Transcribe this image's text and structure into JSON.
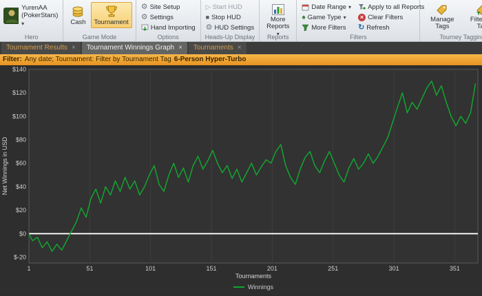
{
  "ribbon": {
    "hero": {
      "name": "YurenAA",
      "site": "(PokerStars)",
      "caption": "Hero"
    },
    "game_mode": {
      "caption": "Game Mode",
      "cash_label": "Cash",
      "tournament_label": "Tournament"
    },
    "options": {
      "caption": "Options",
      "items": [
        "Site Setup",
        "Settings",
        "Hand Importing"
      ]
    },
    "hud": {
      "caption": "Heads-Up Display",
      "items": [
        "Start HUD",
        "Stop HUD",
        "HUD Settings"
      ]
    },
    "reports": {
      "caption": "Reports",
      "more_reports_label": "More Reports"
    },
    "filters": {
      "caption": "Filters",
      "items": [
        "Date Range",
        "Game Type",
        "More Filters",
        "Apply to all Reports",
        "Clear Filters",
        "Refresh"
      ]
    },
    "tagging": {
      "caption": "Tourney Tagging",
      "manage_label": "Manage Tags",
      "filter_label": "Filter for Tag"
    }
  },
  "tabs": [
    {
      "label": "Tournament Results",
      "active": false
    },
    {
      "label": "Tournament Winnings Graph",
      "active": true
    },
    {
      "label": "Tournaments",
      "active": false
    }
  ],
  "filter_bar": {
    "prefix": "Filter:",
    "text": "Any date; Tournament: Filter by Tournament Tag",
    "tag": "6-Person Hyper-Turbo"
  },
  "chart_data": {
    "type": "line",
    "title": "",
    "xlabel": "Tournaments",
    "ylabel": "Net Winnings in USD",
    "xlim": [
      1,
      370
    ],
    "ylim": [
      -25,
      140
    ],
    "x_ticks": [
      1,
      51,
      101,
      151,
      201,
      251,
      301,
      351
    ],
    "y_ticks": [
      140,
      120,
      100,
      80,
      60,
      40,
      20,
      0,
      -20
    ],
    "y_tick_prefix": "$",
    "grid": "vertical-only",
    "zero_line": true,
    "legend_position": "bottom",
    "line_color": "#12a530",
    "background": "#323232",
    "series": [
      {
        "name": "Winnings",
        "x": [
          1,
          4,
          8,
          12,
          16,
          20,
          24,
          28,
          32,
          36,
          40,
          44,
          48,
          52,
          56,
          60,
          64,
          68,
          72,
          76,
          80,
          84,
          88,
          92,
          96,
          100,
          104,
          108,
          112,
          116,
          120,
          124,
          128,
          132,
          136,
          140,
          144,
          148,
          152,
          156,
          160,
          164,
          168,
          172,
          176,
          180,
          184,
          188,
          192,
          196,
          200,
          204,
          208,
          212,
          216,
          220,
          224,
          228,
          232,
          236,
          240,
          244,
          248,
          252,
          256,
          260,
          264,
          268,
          272,
          276,
          280,
          284,
          288,
          292,
          296,
          300,
          304,
          308,
          312,
          316,
          320,
          324,
          328,
          332,
          336,
          340,
          344,
          348,
          352,
          356,
          360,
          364,
          368
        ],
        "y": [
          0,
          -6,
          -3,
          -12,
          -7,
          -15,
          -9,
          -14,
          -6,
          2,
          10,
          22,
          14,
          30,
          38,
          26,
          40,
          33,
          45,
          36,
          48,
          38,
          45,
          33,
          40,
          50,
          58,
          42,
          36,
          50,
          60,
          48,
          56,
          44,
          58,
          66,
          55,
          62,
          71,
          60,
          52,
          58,
          47,
          55,
          44,
          52,
          60,
          50,
          57,
          63,
          60,
          70,
          76,
          58,
          48,
          42,
          55,
          65,
          70,
          58,
          52,
          62,
          70,
          60,
          50,
          44,
          56,
          64,
          55,
          60,
          68,
          60,
          66,
          74,
          82,
          95,
          108,
          120,
          103,
          112,
          106,
          115,
          124,
          130,
          118,
          126,
          112,
          100,
          92,
          100,
          94,
          103,
          128
        ]
      }
    ]
  }
}
